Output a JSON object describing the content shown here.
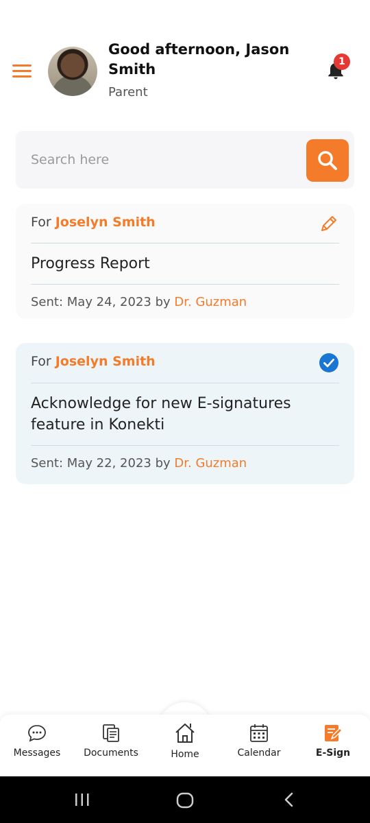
{
  "header": {
    "greeting": "Good afternoon, Jason Smith",
    "role": "Parent",
    "notification_count": "1"
  },
  "search": {
    "placeholder": "Search here"
  },
  "documents": [
    {
      "for_prefix": "For",
      "for_name": "Joselyn Smith",
      "title": "Progress Report",
      "sent_prefix": "Sent: May 24, 2023 by",
      "sent_by": "Dr. Guzman",
      "status_icon": "pencil-icon"
    },
    {
      "for_prefix": "For",
      "for_name": "Joselyn Smith",
      "title": "Acknowledge for new E-signatures feature in Konekti",
      "sent_prefix": "Sent: May 22, 2023 by",
      "sent_by": "Dr. Guzman",
      "status_icon": "check-circle-icon"
    }
  ],
  "nav": {
    "items": [
      {
        "label": "Messages",
        "icon": "chat-icon"
      },
      {
        "label": "Documents",
        "icon": "documents-icon"
      },
      {
        "label": "Home",
        "icon": "home-icon"
      },
      {
        "label": "Calendar",
        "icon": "calendar-icon"
      },
      {
        "label": "E-Sign",
        "icon": "esign-icon"
      }
    ],
    "active": "E-Sign"
  },
  "colors": {
    "accent": "#F47B2A",
    "badge": "#E53935",
    "check": "#1976D2"
  }
}
